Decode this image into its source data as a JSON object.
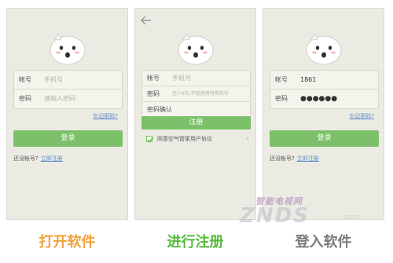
{
  "screens": {
    "open": {
      "account_label": "帐号",
      "account_placeholder": "手机号",
      "password_label": "密码",
      "password_placeholder": "请输入密码",
      "forgot_link": "忘记密码?",
      "login_button": "登录",
      "no_account_text": "还没帐号?",
      "register_link": "立即注册"
    },
    "register": {
      "account_label": "帐号",
      "account_placeholder": "手机号",
      "password_label": "密码",
      "password_placeholder": "至少6位,不能使用特殊符号",
      "confirm_label": "密码确认",
      "register_button": "注册",
      "agree_text": "同意空气管家用户协议",
      "agree_checked": true,
      "chevron": "›"
    },
    "login": {
      "account_label": "帐号",
      "account_value": "1861",
      "password_label": "密码",
      "password_value": "●●●●●●",
      "forgot_link": "忘记密码?",
      "login_button": "登录",
      "no_account_text": "还没帐号?",
      "register_link": "立即注册"
    }
  },
  "captions": {
    "step1": "打开软件",
    "step2": "进行注册",
    "step3": "登入软件"
  },
  "watermark": {
    "tagline": "智能电视网",
    "logo": "ZNDS",
    "suffix": ".com"
  },
  "colors": {
    "accent_green": "#7cc06a",
    "link_blue": "#5a8ec8",
    "phone_bg": "#ecebe3",
    "caption_orange": "#f0a23a",
    "caption_green": "#56b83c",
    "caption_gray": "#7a7a7a"
  }
}
